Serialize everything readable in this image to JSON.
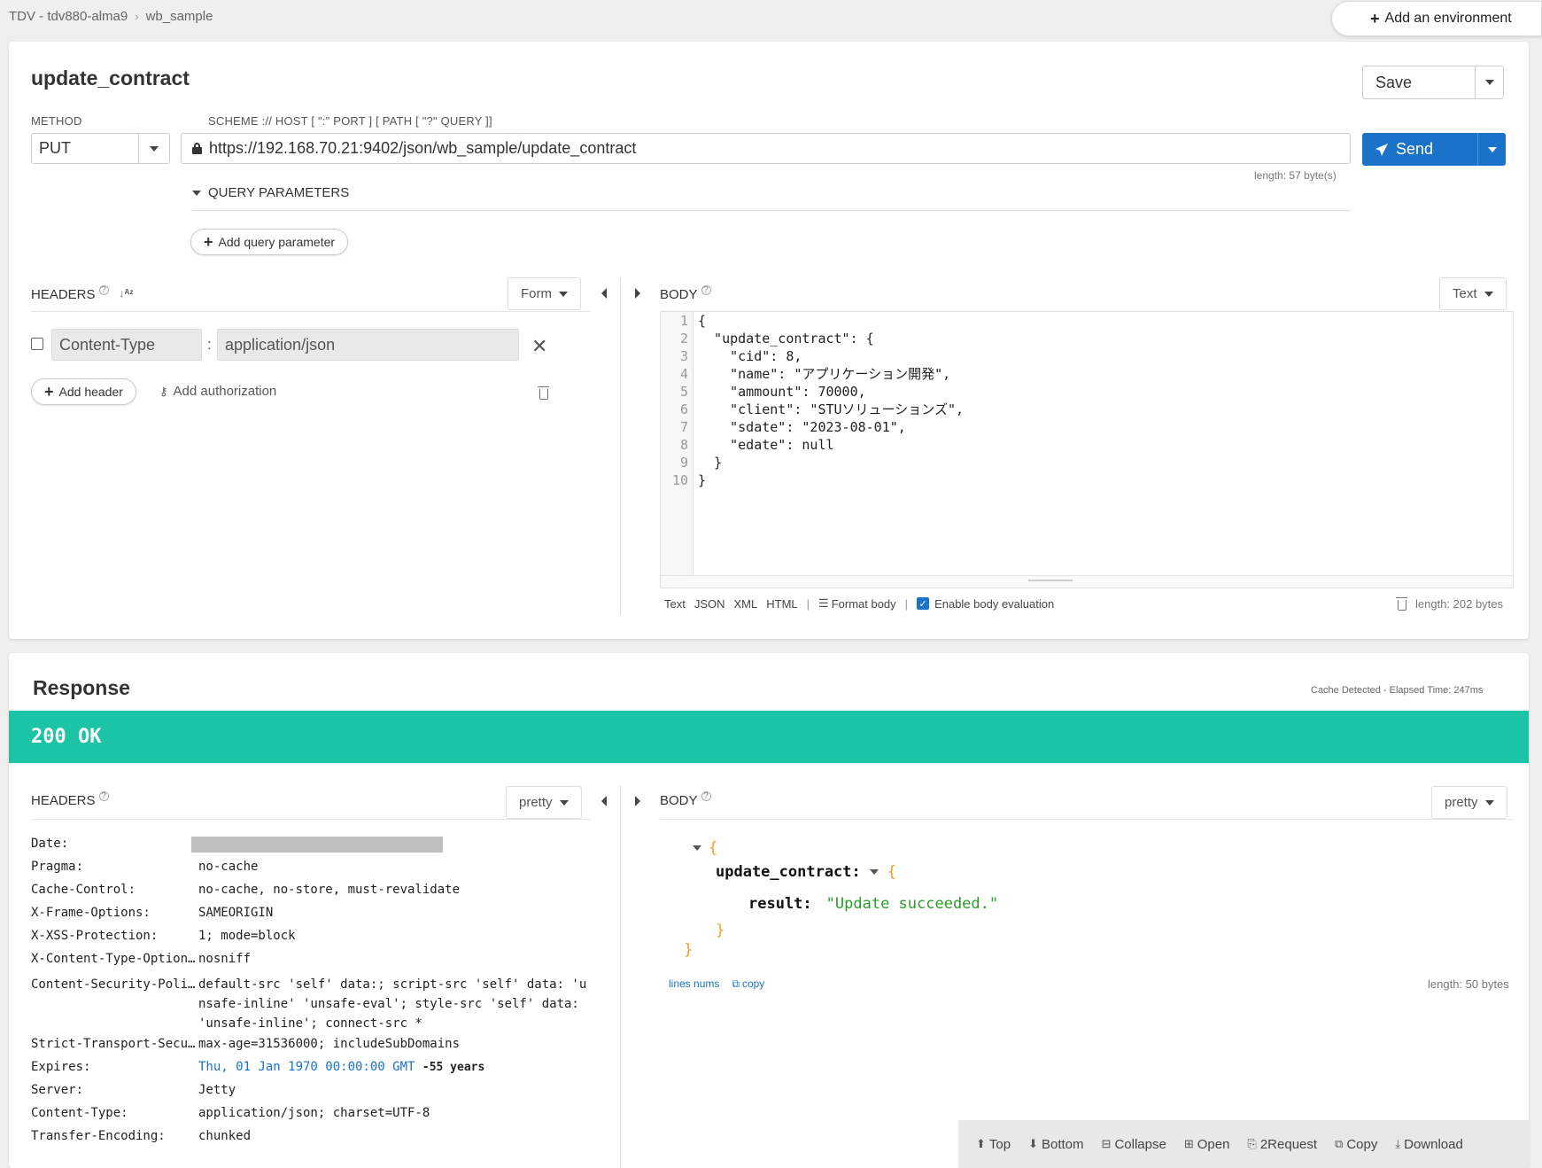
{
  "breadcrumb": {
    "project": "TDV - tdv880-alma9",
    "separator": "›",
    "item": "wb_sample"
  },
  "add_environment": {
    "label": "Add an environment"
  },
  "request": {
    "title": "update_contract",
    "save_label": "Save",
    "method_label": "METHOD",
    "method_value": "PUT",
    "url_label": "SCHEME :// HOST [ \":\" PORT ] [ PATH [ \"?\" QUERY ]]",
    "url_value": "https://192.168.70.21:9402/json/wb_sample/update_contract",
    "url_length": "length: 57 byte(s)",
    "send_label": "Send",
    "query_params_label": "QUERY PARAMETERS",
    "add_query_param_label": "Add query parameter",
    "headers_label": "HEADERS",
    "headers_mode": "Form",
    "header_rows": [
      {
        "name": "Content-Type",
        "sep": ":",
        "value": "application/json"
      }
    ],
    "add_header_label": "Add header",
    "add_auth_label": "Add authorization",
    "body_label": "BODY",
    "body_mode": "Text",
    "body_lines": [
      "{",
      "  \"update_contract\": {",
      "    \"cid\": 8,",
      "    \"name\": \"アプリケーション開発\",",
      "    \"ammount\": 70000,",
      "    \"client\": \"STUソリューションズ\",",
      "    \"sdate\": \"2023-08-01\",",
      "    \"edate\": null",
      "  }",
      "}"
    ],
    "line_numbers": [
      "1",
      "2",
      "3",
      "4",
      "5",
      "6",
      "7",
      "8",
      "9",
      "10"
    ],
    "body_formats": [
      "Text",
      "JSON",
      "XML",
      "HTML"
    ],
    "toolbar_sep": "|",
    "format_body_label": "Format body",
    "enable_eval_label": "Enable body evaluation",
    "body_length": "length: 202 bytes"
  },
  "response": {
    "title": "Response",
    "meta": "Cache Detected - Elapsed Time: 247ms",
    "status": "200 OK",
    "headers_label": "HEADERS",
    "headers_mode": "pretty",
    "body_label": "BODY",
    "body_mode": "pretty",
    "headers": [
      {
        "key": "Date:",
        "value": ""
      },
      {
        "key": "Pragma:",
        "value": "no-cache"
      },
      {
        "key": "Cache-Control:",
        "value": "no-cache, no-store, must-revalidate"
      },
      {
        "key": "X-Frame-Options:",
        "value": "SAMEORIGIN"
      },
      {
        "key": "X-XSS-Protection:",
        "value": "1; mode=block"
      },
      {
        "key": "X-Content-Type-Option…",
        "value": "nosniff"
      },
      {
        "key": "Content-Security-Poli…",
        "value": "default-src 'self' data:; script-src 'self' data: 'unsafe-inline' 'unsafe-eval'; style-src 'self' data: 'unsafe-inline'; connect-src *"
      },
      {
        "key": "Strict-Transport-Secu…",
        "value": "max-age=31536000; includeSubDomains"
      },
      {
        "key": "Expires:",
        "value": "Thu, 01 Jan 1970 00:00:00 GMT",
        "extra": "-55 years"
      },
      {
        "key": "Server:",
        "value": "Jetty"
      },
      {
        "key": "Content-Type:",
        "value": "application/json; charset=UTF-8"
      },
      {
        "key": "Transfer-Encoding:",
        "value": "chunked"
      }
    ],
    "json_root_key": "update_contract:",
    "json_result_key": "result:",
    "json_result_value": "\"Update succeeded.\"",
    "brace_open": "{",
    "brace_close": "}",
    "lines_nums_label": "lines nums",
    "copy_label": "copy",
    "body_length": "length: 50 bytes"
  },
  "bottom_bar": {
    "top": "Top",
    "bottom": "Bottom",
    "collapse": "Collapse",
    "open": "Open",
    "to_request": "2Request",
    "copy": "Copy",
    "download": "Download"
  },
  "colors": {
    "accent": "#1a73c9",
    "status_ok": "#1bc4a4",
    "json_brace": "#f0a020",
    "json_string": "#2a9a2a"
  }
}
